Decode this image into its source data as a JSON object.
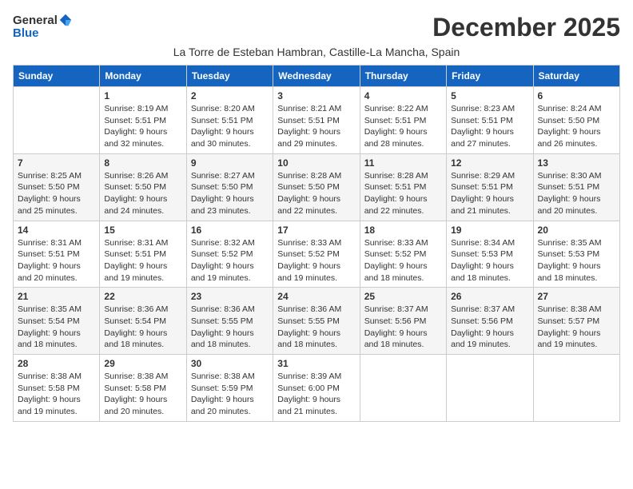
{
  "header": {
    "logo_general": "General",
    "logo_blue": "Blue",
    "month_title": "December 2025",
    "subtitle": "La Torre de Esteban Hambran, Castille-La Mancha, Spain"
  },
  "weekdays": [
    "Sunday",
    "Monday",
    "Tuesday",
    "Wednesday",
    "Thursday",
    "Friday",
    "Saturday"
  ],
  "weeks": [
    [
      {
        "day": "",
        "sunrise": "",
        "sunset": "",
        "daylight": ""
      },
      {
        "day": "1",
        "sunrise": "Sunrise: 8:19 AM",
        "sunset": "Sunset: 5:51 PM",
        "daylight": "Daylight: 9 hours and 32 minutes."
      },
      {
        "day": "2",
        "sunrise": "Sunrise: 8:20 AM",
        "sunset": "Sunset: 5:51 PM",
        "daylight": "Daylight: 9 hours and 30 minutes."
      },
      {
        "day": "3",
        "sunrise": "Sunrise: 8:21 AM",
        "sunset": "Sunset: 5:51 PM",
        "daylight": "Daylight: 9 hours and 29 minutes."
      },
      {
        "day": "4",
        "sunrise": "Sunrise: 8:22 AM",
        "sunset": "Sunset: 5:51 PM",
        "daylight": "Daylight: 9 hours and 28 minutes."
      },
      {
        "day": "5",
        "sunrise": "Sunrise: 8:23 AM",
        "sunset": "Sunset: 5:51 PM",
        "daylight": "Daylight: 9 hours and 27 minutes."
      },
      {
        "day": "6",
        "sunrise": "Sunrise: 8:24 AM",
        "sunset": "Sunset: 5:50 PM",
        "daylight": "Daylight: 9 hours and 26 minutes."
      }
    ],
    [
      {
        "day": "7",
        "sunrise": "Sunrise: 8:25 AM",
        "sunset": "Sunset: 5:50 PM",
        "daylight": "Daylight: 9 hours and 25 minutes."
      },
      {
        "day": "8",
        "sunrise": "Sunrise: 8:26 AM",
        "sunset": "Sunset: 5:50 PM",
        "daylight": "Daylight: 9 hours and 24 minutes."
      },
      {
        "day": "9",
        "sunrise": "Sunrise: 8:27 AM",
        "sunset": "Sunset: 5:50 PM",
        "daylight": "Daylight: 9 hours and 23 minutes."
      },
      {
        "day": "10",
        "sunrise": "Sunrise: 8:28 AM",
        "sunset": "Sunset: 5:50 PM",
        "daylight": "Daylight: 9 hours and 22 minutes."
      },
      {
        "day": "11",
        "sunrise": "Sunrise: 8:28 AM",
        "sunset": "Sunset: 5:51 PM",
        "daylight": "Daylight: 9 hours and 22 minutes."
      },
      {
        "day": "12",
        "sunrise": "Sunrise: 8:29 AM",
        "sunset": "Sunset: 5:51 PM",
        "daylight": "Daylight: 9 hours and 21 minutes."
      },
      {
        "day": "13",
        "sunrise": "Sunrise: 8:30 AM",
        "sunset": "Sunset: 5:51 PM",
        "daylight": "Daylight: 9 hours and 20 minutes."
      }
    ],
    [
      {
        "day": "14",
        "sunrise": "Sunrise: 8:31 AM",
        "sunset": "Sunset: 5:51 PM",
        "daylight": "Daylight: 9 hours and 20 minutes."
      },
      {
        "day": "15",
        "sunrise": "Sunrise: 8:31 AM",
        "sunset": "Sunset: 5:51 PM",
        "daylight": "Daylight: 9 hours and 19 minutes."
      },
      {
        "day": "16",
        "sunrise": "Sunrise: 8:32 AM",
        "sunset": "Sunset: 5:52 PM",
        "daylight": "Daylight: 9 hours and 19 minutes."
      },
      {
        "day": "17",
        "sunrise": "Sunrise: 8:33 AM",
        "sunset": "Sunset: 5:52 PM",
        "daylight": "Daylight: 9 hours and 19 minutes."
      },
      {
        "day": "18",
        "sunrise": "Sunrise: 8:33 AM",
        "sunset": "Sunset: 5:52 PM",
        "daylight": "Daylight: 9 hours and 18 minutes."
      },
      {
        "day": "19",
        "sunrise": "Sunrise: 8:34 AM",
        "sunset": "Sunset: 5:53 PM",
        "daylight": "Daylight: 9 hours and 18 minutes."
      },
      {
        "day": "20",
        "sunrise": "Sunrise: 8:35 AM",
        "sunset": "Sunset: 5:53 PM",
        "daylight": "Daylight: 9 hours and 18 minutes."
      }
    ],
    [
      {
        "day": "21",
        "sunrise": "Sunrise: 8:35 AM",
        "sunset": "Sunset: 5:54 PM",
        "daylight": "Daylight: 9 hours and 18 minutes."
      },
      {
        "day": "22",
        "sunrise": "Sunrise: 8:36 AM",
        "sunset": "Sunset: 5:54 PM",
        "daylight": "Daylight: 9 hours and 18 minutes."
      },
      {
        "day": "23",
        "sunrise": "Sunrise: 8:36 AM",
        "sunset": "Sunset: 5:55 PM",
        "daylight": "Daylight: 9 hours and 18 minutes."
      },
      {
        "day": "24",
        "sunrise": "Sunrise: 8:36 AM",
        "sunset": "Sunset: 5:55 PM",
        "daylight": "Daylight: 9 hours and 18 minutes."
      },
      {
        "day": "25",
        "sunrise": "Sunrise: 8:37 AM",
        "sunset": "Sunset: 5:56 PM",
        "daylight": "Daylight: 9 hours and 18 minutes."
      },
      {
        "day": "26",
        "sunrise": "Sunrise: 8:37 AM",
        "sunset": "Sunset: 5:56 PM",
        "daylight": "Daylight: 9 hours and 19 minutes."
      },
      {
        "day": "27",
        "sunrise": "Sunrise: 8:38 AM",
        "sunset": "Sunset: 5:57 PM",
        "daylight": "Daylight: 9 hours and 19 minutes."
      }
    ],
    [
      {
        "day": "28",
        "sunrise": "Sunrise: 8:38 AM",
        "sunset": "Sunset: 5:58 PM",
        "daylight": "Daylight: 9 hours and 19 minutes."
      },
      {
        "day": "29",
        "sunrise": "Sunrise: 8:38 AM",
        "sunset": "Sunset: 5:58 PM",
        "daylight": "Daylight: 9 hours and 20 minutes."
      },
      {
        "day": "30",
        "sunrise": "Sunrise: 8:38 AM",
        "sunset": "Sunset: 5:59 PM",
        "daylight": "Daylight: 9 hours and 20 minutes."
      },
      {
        "day": "31",
        "sunrise": "Sunrise: 8:39 AM",
        "sunset": "Sunset: 6:00 PM",
        "daylight": "Daylight: 9 hours and 21 minutes."
      },
      {
        "day": "",
        "sunrise": "",
        "sunset": "",
        "daylight": ""
      },
      {
        "day": "",
        "sunrise": "",
        "sunset": "",
        "daylight": ""
      },
      {
        "day": "",
        "sunrise": "",
        "sunset": "",
        "daylight": ""
      }
    ]
  ]
}
